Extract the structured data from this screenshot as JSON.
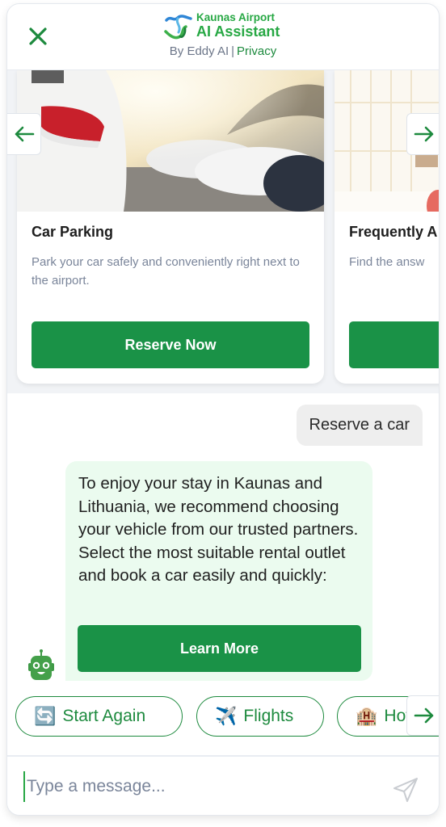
{
  "header": {
    "logo_line1": "Kaunas Airport",
    "logo_line2": "AI Assistant",
    "byline": "By Eddy AI",
    "privacy_link": "Privacy",
    "close_icon": "close-icon"
  },
  "colors": {
    "brand_green": "#1a9247",
    "logo_green": "#27a844",
    "bot_bubble_bg": "#ebfbef",
    "user_bubble_bg": "#eeeeee",
    "muted_text": "#7a859a"
  },
  "carousel": {
    "cards": [
      {
        "title": "Car Parking",
        "description": "Park your car safely and conveniently right next to the airport.",
        "button_label": "Reserve Now",
        "image": "parked-cars-photo"
      },
      {
        "title": "Frequently A",
        "description": "Find the answ",
        "button_label": "",
        "image": "airport-terminal-photo"
      }
    ],
    "prev_icon": "arrow-left-icon",
    "next_icon": "arrow-right-icon"
  },
  "chat": {
    "messages": [
      {
        "sender": "user",
        "text": "Reserve a car"
      },
      {
        "sender": "bot",
        "text": "To enjoy your stay in Kaunas and Lithuania, we recommend choosing your vehicle from our trusted partners. Select the most suitable rental outlet and book a car easily and quickly:",
        "button_label": "Learn More"
      }
    ],
    "bot_avatar": "robot-icon"
  },
  "quick_replies": [
    {
      "emoji": "🔄",
      "label": "Start Again"
    },
    {
      "emoji": "✈️",
      "label": "Flights"
    },
    {
      "emoji": "🏨",
      "label": "Hotels"
    }
  ],
  "composer": {
    "placeholder": "Type a message...",
    "value": "",
    "send_icon": "send-icon"
  }
}
